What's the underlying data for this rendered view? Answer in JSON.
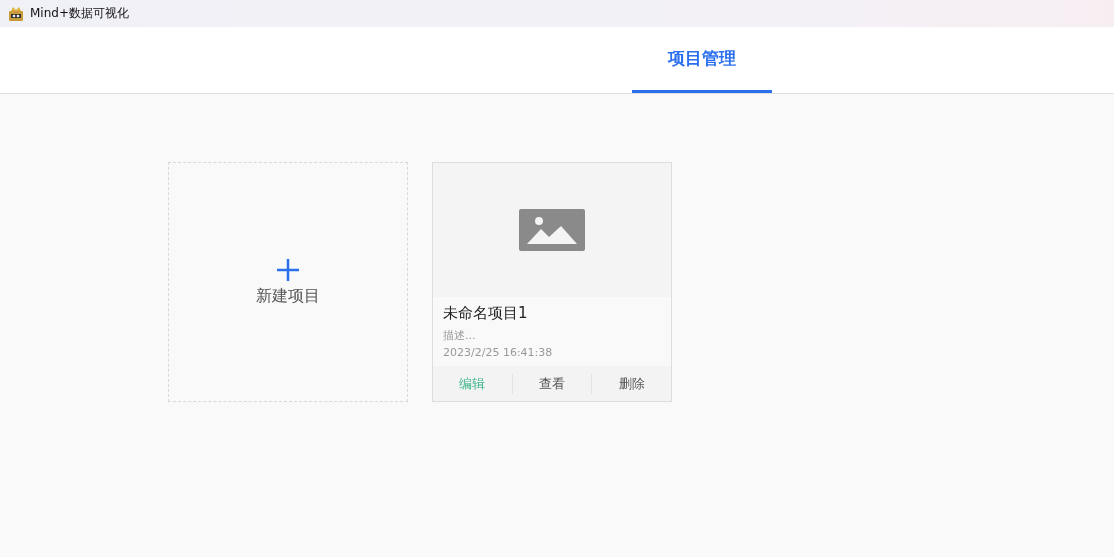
{
  "window": {
    "title": "Mind+数据可视化"
  },
  "tabs": [
    {
      "label": "项目管理",
      "selected": true
    }
  ],
  "new_project": {
    "label": "新建项目"
  },
  "projects": [
    {
      "kind": "picture",
      "name": "未命名项目1",
      "description": "描述...",
      "time": "2023/2/25 16:41:38",
      "actions": [
        {
          "label": "编辑",
          "color": "#3fb58a"
        },
        {
          "label": "查看",
          "color": "#555555"
        },
        {
          "label": "删除",
          "color": "#555555"
        }
      ]
    }
  ]
}
